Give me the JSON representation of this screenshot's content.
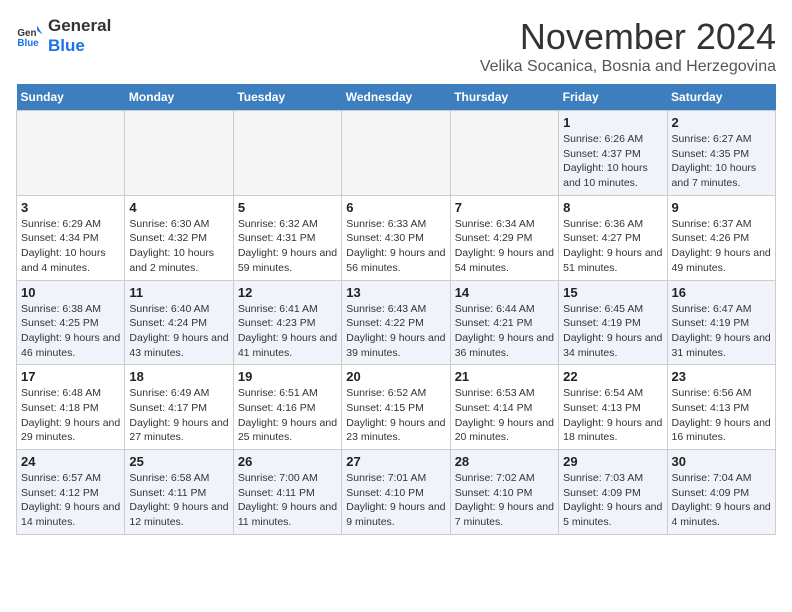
{
  "logo": {
    "general": "General",
    "blue": "Blue"
  },
  "header": {
    "month": "November 2024",
    "location": "Velika Socanica, Bosnia and Herzegovina"
  },
  "weekdays": [
    "Sunday",
    "Monday",
    "Tuesday",
    "Wednesday",
    "Thursday",
    "Friday",
    "Saturday"
  ],
  "weeks": [
    [
      {
        "day": "",
        "info": ""
      },
      {
        "day": "",
        "info": ""
      },
      {
        "day": "",
        "info": ""
      },
      {
        "day": "",
        "info": ""
      },
      {
        "day": "",
        "info": ""
      },
      {
        "day": "1",
        "info": "Sunrise: 6:26 AM\nSunset: 4:37 PM\nDaylight: 10 hours and 10 minutes."
      },
      {
        "day": "2",
        "info": "Sunrise: 6:27 AM\nSunset: 4:35 PM\nDaylight: 10 hours and 7 minutes."
      }
    ],
    [
      {
        "day": "3",
        "info": "Sunrise: 6:29 AM\nSunset: 4:34 PM\nDaylight: 10 hours and 4 minutes."
      },
      {
        "day": "4",
        "info": "Sunrise: 6:30 AM\nSunset: 4:32 PM\nDaylight: 10 hours and 2 minutes."
      },
      {
        "day": "5",
        "info": "Sunrise: 6:32 AM\nSunset: 4:31 PM\nDaylight: 9 hours and 59 minutes."
      },
      {
        "day": "6",
        "info": "Sunrise: 6:33 AM\nSunset: 4:30 PM\nDaylight: 9 hours and 56 minutes."
      },
      {
        "day": "7",
        "info": "Sunrise: 6:34 AM\nSunset: 4:29 PM\nDaylight: 9 hours and 54 minutes."
      },
      {
        "day": "8",
        "info": "Sunrise: 6:36 AM\nSunset: 4:27 PM\nDaylight: 9 hours and 51 minutes."
      },
      {
        "day": "9",
        "info": "Sunrise: 6:37 AM\nSunset: 4:26 PM\nDaylight: 9 hours and 49 minutes."
      }
    ],
    [
      {
        "day": "10",
        "info": "Sunrise: 6:38 AM\nSunset: 4:25 PM\nDaylight: 9 hours and 46 minutes."
      },
      {
        "day": "11",
        "info": "Sunrise: 6:40 AM\nSunset: 4:24 PM\nDaylight: 9 hours and 43 minutes."
      },
      {
        "day": "12",
        "info": "Sunrise: 6:41 AM\nSunset: 4:23 PM\nDaylight: 9 hours and 41 minutes."
      },
      {
        "day": "13",
        "info": "Sunrise: 6:43 AM\nSunset: 4:22 PM\nDaylight: 9 hours and 39 minutes."
      },
      {
        "day": "14",
        "info": "Sunrise: 6:44 AM\nSunset: 4:21 PM\nDaylight: 9 hours and 36 minutes."
      },
      {
        "day": "15",
        "info": "Sunrise: 6:45 AM\nSunset: 4:19 PM\nDaylight: 9 hours and 34 minutes."
      },
      {
        "day": "16",
        "info": "Sunrise: 6:47 AM\nSunset: 4:19 PM\nDaylight: 9 hours and 31 minutes."
      }
    ],
    [
      {
        "day": "17",
        "info": "Sunrise: 6:48 AM\nSunset: 4:18 PM\nDaylight: 9 hours and 29 minutes."
      },
      {
        "day": "18",
        "info": "Sunrise: 6:49 AM\nSunset: 4:17 PM\nDaylight: 9 hours and 27 minutes."
      },
      {
        "day": "19",
        "info": "Sunrise: 6:51 AM\nSunset: 4:16 PM\nDaylight: 9 hours and 25 minutes."
      },
      {
        "day": "20",
        "info": "Sunrise: 6:52 AM\nSunset: 4:15 PM\nDaylight: 9 hours and 23 minutes."
      },
      {
        "day": "21",
        "info": "Sunrise: 6:53 AM\nSunset: 4:14 PM\nDaylight: 9 hours and 20 minutes."
      },
      {
        "day": "22",
        "info": "Sunrise: 6:54 AM\nSunset: 4:13 PM\nDaylight: 9 hours and 18 minutes."
      },
      {
        "day": "23",
        "info": "Sunrise: 6:56 AM\nSunset: 4:13 PM\nDaylight: 9 hours and 16 minutes."
      }
    ],
    [
      {
        "day": "24",
        "info": "Sunrise: 6:57 AM\nSunset: 4:12 PM\nDaylight: 9 hours and 14 minutes."
      },
      {
        "day": "25",
        "info": "Sunrise: 6:58 AM\nSunset: 4:11 PM\nDaylight: 9 hours and 12 minutes."
      },
      {
        "day": "26",
        "info": "Sunrise: 7:00 AM\nSunset: 4:11 PM\nDaylight: 9 hours and 11 minutes."
      },
      {
        "day": "27",
        "info": "Sunrise: 7:01 AM\nSunset: 4:10 PM\nDaylight: 9 hours and 9 minutes."
      },
      {
        "day": "28",
        "info": "Sunrise: 7:02 AM\nSunset: 4:10 PM\nDaylight: 9 hours and 7 minutes."
      },
      {
        "day": "29",
        "info": "Sunrise: 7:03 AM\nSunset: 4:09 PM\nDaylight: 9 hours and 5 minutes."
      },
      {
        "day": "30",
        "info": "Sunrise: 7:04 AM\nSunset: 4:09 PM\nDaylight: 9 hours and 4 minutes."
      }
    ]
  ]
}
